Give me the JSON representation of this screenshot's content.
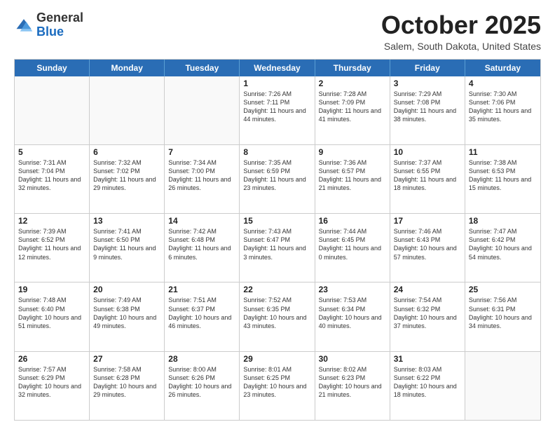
{
  "header": {
    "logo_general": "General",
    "logo_blue": "Blue",
    "month_title": "October 2025",
    "location": "Salem, South Dakota, United States"
  },
  "days_of_week": [
    "Sunday",
    "Monday",
    "Tuesday",
    "Wednesday",
    "Thursday",
    "Friday",
    "Saturday"
  ],
  "weeks": [
    [
      {
        "day": "",
        "sunrise": "",
        "sunset": "",
        "daylight": "",
        "empty": true
      },
      {
        "day": "",
        "sunrise": "",
        "sunset": "",
        "daylight": "",
        "empty": true
      },
      {
        "day": "",
        "sunrise": "",
        "sunset": "",
        "daylight": "",
        "empty": true
      },
      {
        "day": "1",
        "sunrise": "Sunrise: 7:26 AM",
        "sunset": "Sunset: 7:11 PM",
        "daylight": "Daylight: 11 hours and 44 minutes.",
        "empty": false
      },
      {
        "day": "2",
        "sunrise": "Sunrise: 7:28 AM",
        "sunset": "Sunset: 7:09 PM",
        "daylight": "Daylight: 11 hours and 41 minutes.",
        "empty": false
      },
      {
        "day": "3",
        "sunrise": "Sunrise: 7:29 AM",
        "sunset": "Sunset: 7:08 PM",
        "daylight": "Daylight: 11 hours and 38 minutes.",
        "empty": false
      },
      {
        "day": "4",
        "sunrise": "Sunrise: 7:30 AM",
        "sunset": "Sunset: 7:06 PM",
        "daylight": "Daylight: 11 hours and 35 minutes.",
        "empty": false
      }
    ],
    [
      {
        "day": "5",
        "sunrise": "Sunrise: 7:31 AM",
        "sunset": "Sunset: 7:04 PM",
        "daylight": "Daylight: 11 hours and 32 minutes.",
        "empty": false
      },
      {
        "day": "6",
        "sunrise": "Sunrise: 7:32 AM",
        "sunset": "Sunset: 7:02 PM",
        "daylight": "Daylight: 11 hours and 29 minutes.",
        "empty": false
      },
      {
        "day": "7",
        "sunrise": "Sunrise: 7:34 AM",
        "sunset": "Sunset: 7:00 PM",
        "daylight": "Daylight: 11 hours and 26 minutes.",
        "empty": false
      },
      {
        "day": "8",
        "sunrise": "Sunrise: 7:35 AM",
        "sunset": "Sunset: 6:59 PM",
        "daylight": "Daylight: 11 hours and 23 minutes.",
        "empty": false
      },
      {
        "day": "9",
        "sunrise": "Sunrise: 7:36 AM",
        "sunset": "Sunset: 6:57 PM",
        "daylight": "Daylight: 11 hours and 21 minutes.",
        "empty": false
      },
      {
        "day": "10",
        "sunrise": "Sunrise: 7:37 AM",
        "sunset": "Sunset: 6:55 PM",
        "daylight": "Daylight: 11 hours and 18 minutes.",
        "empty": false
      },
      {
        "day": "11",
        "sunrise": "Sunrise: 7:38 AM",
        "sunset": "Sunset: 6:53 PM",
        "daylight": "Daylight: 11 hours and 15 minutes.",
        "empty": false
      }
    ],
    [
      {
        "day": "12",
        "sunrise": "Sunrise: 7:39 AM",
        "sunset": "Sunset: 6:52 PM",
        "daylight": "Daylight: 11 hours and 12 minutes.",
        "empty": false
      },
      {
        "day": "13",
        "sunrise": "Sunrise: 7:41 AM",
        "sunset": "Sunset: 6:50 PM",
        "daylight": "Daylight: 11 hours and 9 minutes.",
        "empty": false
      },
      {
        "day": "14",
        "sunrise": "Sunrise: 7:42 AM",
        "sunset": "Sunset: 6:48 PM",
        "daylight": "Daylight: 11 hours and 6 minutes.",
        "empty": false
      },
      {
        "day": "15",
        "sunrise": "Sunrise: 7:43 AM",
        "sunset": "Sunset: 6:47 PM",
        "daylight": "Daylight: 11 hours and 3 minutes.",
        "empty": false
      },
      {
        "day": "16",
        "sunrise": "Sunrise: 7:44 AM",
        "sunset": "Sunset: 6:45 PM",
        "daylight": "Daylight: 11 hours and 0 minutes.",
        "empty": false
      },
      {
        "day": "17",
        "sunrise": "Sunrise: 7:46 AM",
        "sunset": "Sunset: 6:43 PM",
        "daylight": "Daylight: 10 hours and 57 minutes.",
        "empty": false
      },
      {
        "day": "18",
        "sunrise": "Sunrise: 7:47 AM",
        "sunset": "Sunset: 6:42 PM",
        "daylight": "Daylight: 10 hours and 54 minutes.",
        "empty": false
      }
    ],
    [
      {
        "day": "19",
        "sunrise": "Sunrise: 7:48 AM",
        "sunset": "Sunset: 6:40 PM",
        "daylight": "Daylight: 10 hours and 51 minutes.",
        "empty": false
      },
      {
        "day": "20",
        "sunrise": "Sunrise: 7:49 AM",
        "sunset": "Sunset: 6:38 PM",
        "daylight": "Daylight: 10 hours and 49 minutes.",
        "empty": false
      },
      {
        "day": "21",
        "sunrise": "Sunrise: 7:51 AM",
        "sunset": "Sunset: 6:37 PM",
        "daylight": "Daylight: 10 hours and 46 minutes.",
        "empty": false
      },
      {
        "day": "22",
        "sunrise": "Sunrise: 7:52 AM",
        "sunset": "Sunset: 6:35 PM",
        "daylight": "Daylight: 10 hours and 43 minutes.",
        "empty": false
      },
      {
        "day": "23",
        "sunrise": "Sunrise: 7:53 AM",
        "sunset": "Sunset: 6:34 PM",
        "daylight": "Daylight: 10 hours and 40 minutes.",
        "empty": false
      },
      {
        "day": "24",
        "sunrise": "Sunrise: 7:54 AM",
        "sunset": "Sunset: 6:32 PM",
        "daylight": "Daylight: 10 hours and 37 minutes.",
        "empty": false
      },
      {
        "day": "25",
        "sunrise": "Sunrise: 7:56 AM",
        "sunset": "Sunset: 6:31 PM",
        "daylight": "Daylight: 10 hours and 34 minutes.",
        "empty": false
      }
    ],
    [
      {
        "day": "26",
        "sunrise": "Sunrise: 7:57 AM",
        "sunset": "Sunset: 6:29 PM",
        "daylight": "Daylight: 10 hours and 32 minutes.",
        "empty": false
      },
      {
        "day": "27",
        "sunrise": "Sunrise: 7:58 AM",
        "sunset": "Sunset: 6:28 PM",
        "daylight": "Daylight: 10 hours and 29 minutes.",
        "empty": false
      },
      {
        "day": "28",
        "sunrise": "Sunrise: 8:00 AM",
        "sunset": "Sunset: 6:26 PM",
        "daylight": "Daylight: 10 hours and 26 minutes.",
        "empty": false
      },
      {
        "day": "29",
        "sunrise": "Sunrise: 8:01 AM",
        "sunset": "Sunset: 6:25 PM",
        "daylight": "Daylight: 10 hours and 23 minutes.",
        "empty": false
      },
      {
        "day": "30",
        "sunrise": "Sunrise: 8:02 AM",
        "sunset": "Sunset: 6:23 PM",
        "daylight": "Daylight: 10 hours and 21 minutes.",
        "empty": false
      },
      {
        "day": "31",
        "sunrise": "Sunrise: 8:03 AM",
        "sunset": "Sunset: 6:22 PM",
        "daylight": "Daylight: 10 hours and 18 minutes.",
        "empty": false
      },
      {
        "day": "",
        "sunrise": "",
        "sunset": "",
        "daylight": "",
        "empty": true
      }
    ]
  ]
}
